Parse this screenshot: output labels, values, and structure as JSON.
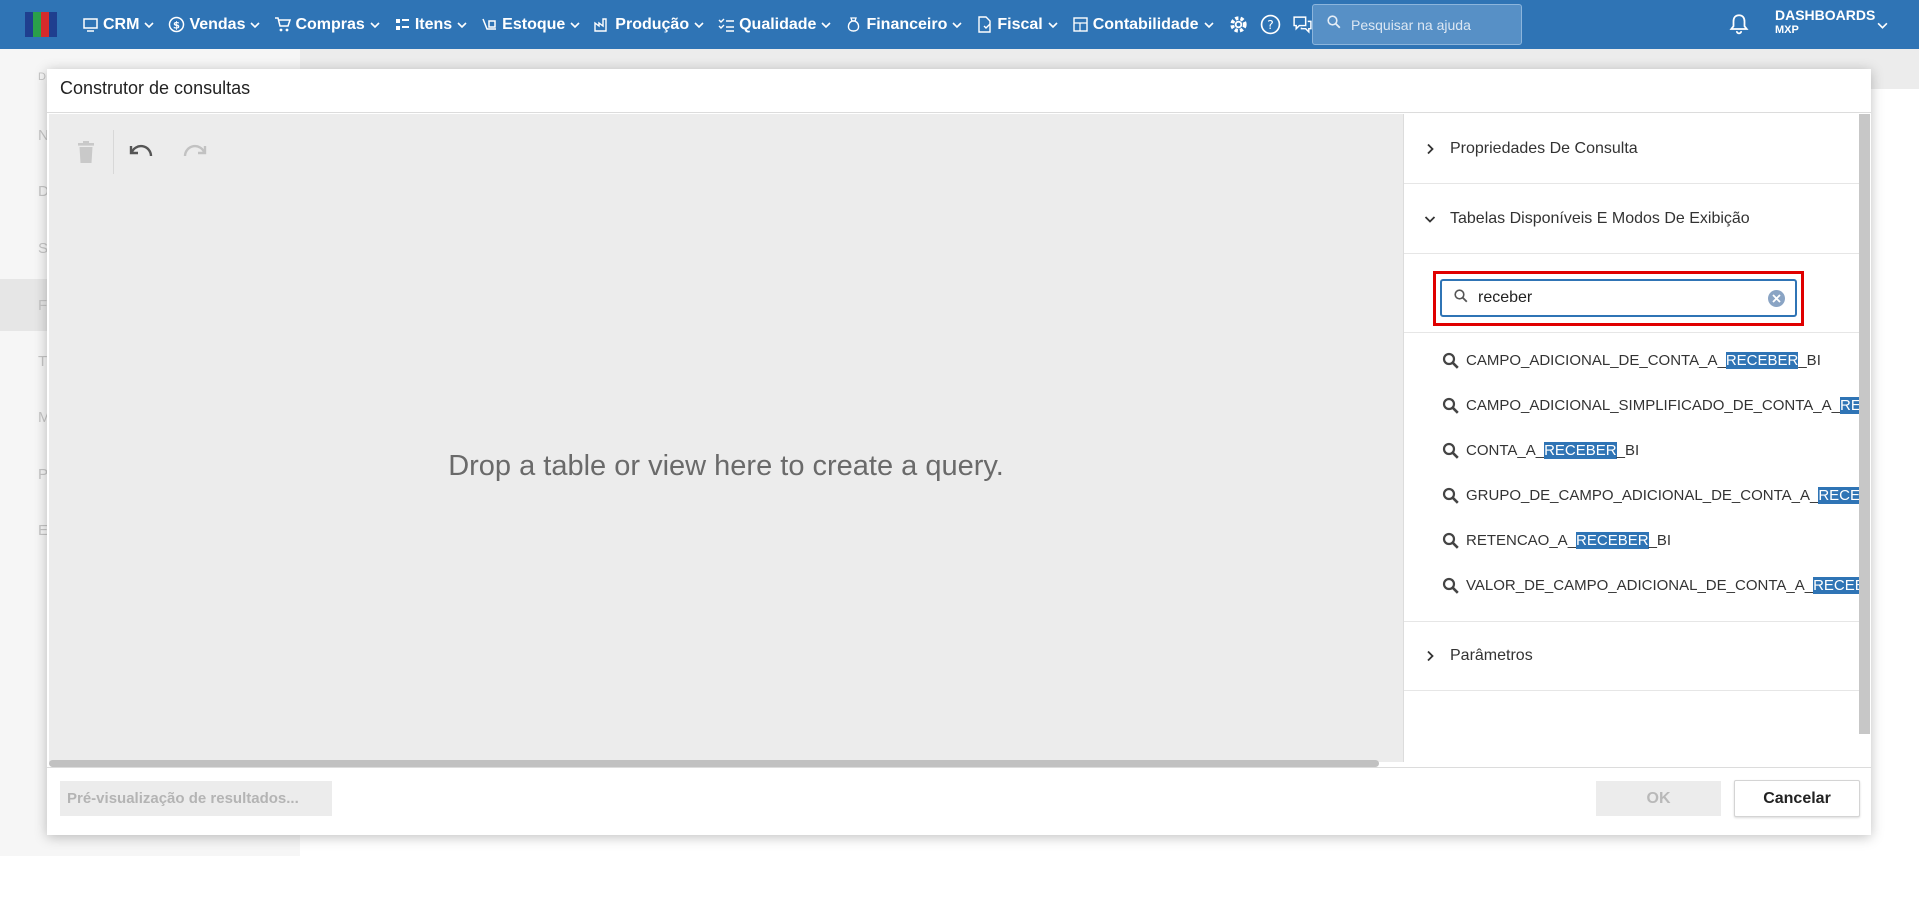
{
  "nav": {
    "items": [
      {
        "label": "CRM",
        "icon": "crm-icon"
      },
      {
        "label": "Vendas",
        "icon": "dollar-icon"
      },
      {
        "label": "Compras",
        "icon": "cart-icon"
      },
      {
        "label": "Itens",
        "icon": "items-icon"
      },
      {
        "label": "Estoque",
        "icon": "stock-icon"
      },
      {
        "label": "Produção",
        "icon": "factory-icon"
      },
      {
        "label": "Qualidade",
        "icon": "checklist-icon"
      },
      {
        "label": "Financeiro",
        "icon": "money-bag-icon"
      },
      {
        "label": "Fiscal",
        "icon": "fiscal-doc-icon"
      },
      {
        "label": "Contabilidade",
        "icon": "calculator-icon"
      }
    ],
    "help_search_placeholder": "Pesquisar na ajuda",
    "dashboards_label": "DASHBOARDS",
    "dashboards_sub": "MXP"
  },
  "background": {
    "side_letters": [
      "D",
      "N",
      "D",
      "S",
      "F",
      "T",
      "M",
      "P",
      "E"
    ]
  },
  "modal": {
    "title": "Construtor de consultas",
    "drop_message": "Drop a table or view here to create a query.",
    "panel": {
      "query_properties": "Propriedades De Consulta",
      "tables_section": "Tabelas Disponíveis E Modos De Exibição",
      "search_value": "receber",
      "results": [
        {
          "pre": "CAMPO_ADICIONAL_DE_CONTA_A_",
          "hl": "RECEBER",
          "post": "_BI"
        },
        {
          "pre": "CAMPO_ADICIONAL_SIMPLIFICADO_DE_CONTA_A_",
          "hl": "RE",
          "post": ""
        },
        {
          "pre": "CONTA_A_",
          "hl": "RECEBER",
          "post": "_BI"
        },
        {
          "pre": "GRUPO_DE_CAMPO_ADICIONAL_DE_CONTA_A_",
          "hl": "RECEB",
          "post": ""
        },
        {
          "pre": "RETENCAO_A_",
          "hl": "RECEBER",
          "post": "_BI"
        },
        {
          "pre": "VALOR_DE_CAMPO_ADICIONAL_DE_CONTA_A_",
          "hl": "RECEBE",
          "post": ""
        }
      ],
      "parameters": "Parâmetros"
    },
    "footer": {
      "preview_label": "Pré-visualização de resultados...",
      "ok_label": "OK",
      "cancel_label": "Cancelar"
    }
  },
  "colors": {
    "brand_blue": "#2f74b5",
    "highlight_red": "#e00000"
  }
}
